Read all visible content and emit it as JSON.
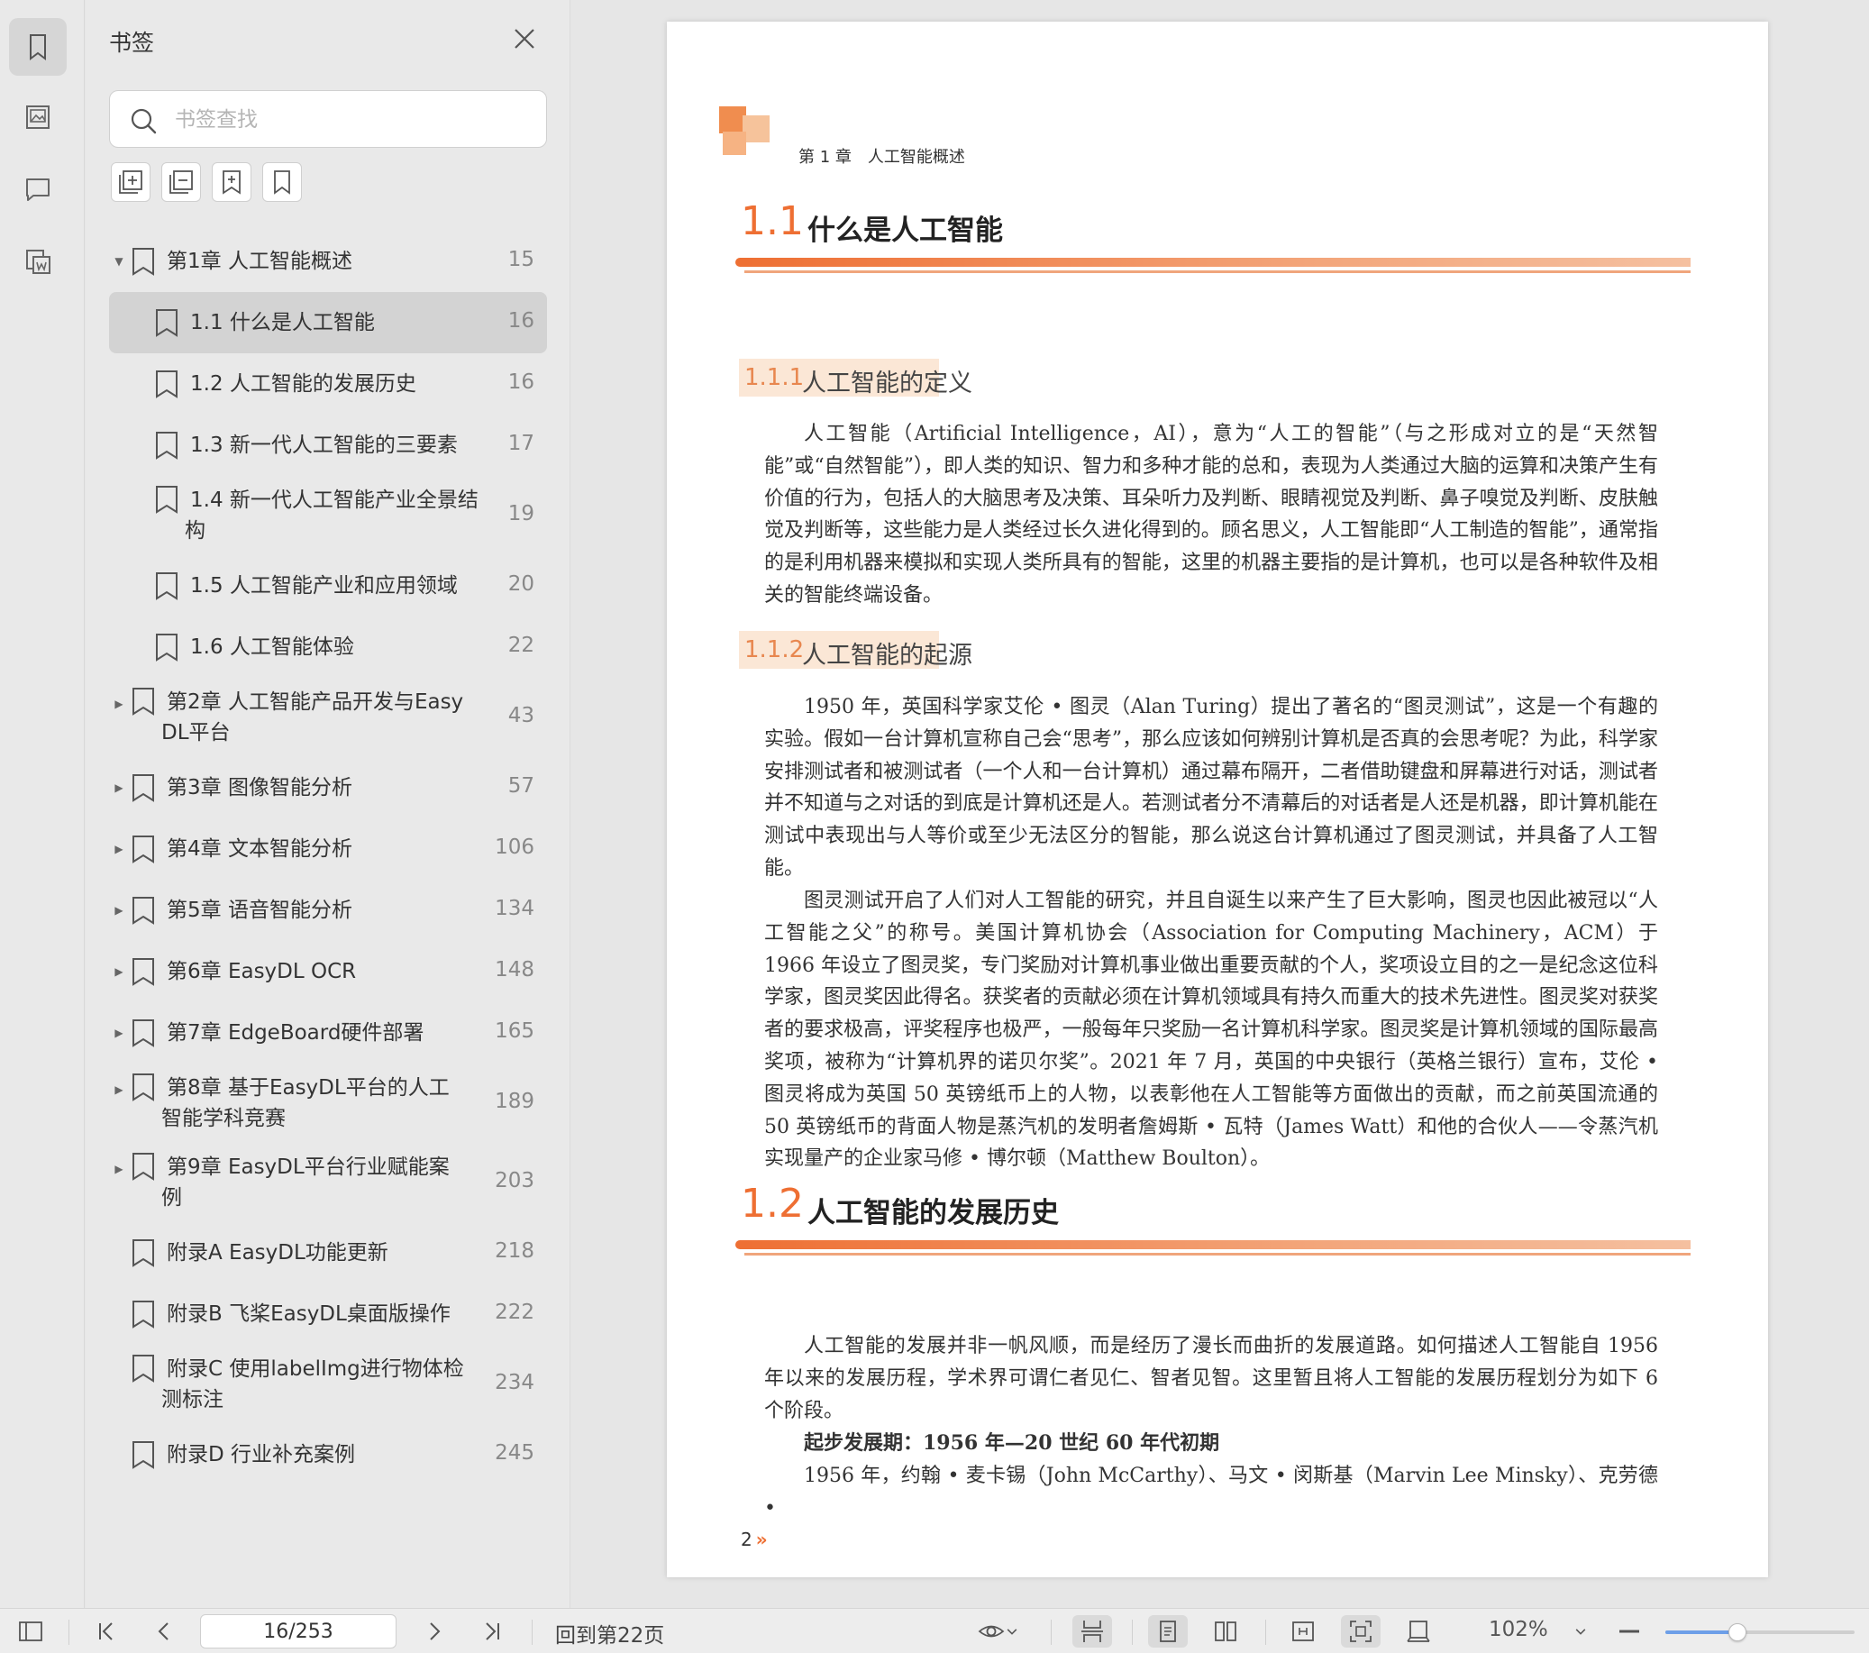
{
  "panel": {
    "title": "书签",
    "search_placeholder": "书签查找"
  },
  "bookmarks": [
    {
      "label": "第1章 人工智能概述",
      "page": "15",
      "level": 0,
      "expandable": true,
      "expanded": true
    },
    {
      "label": "1.1 什么是人工智能",
      "page": "16",
      "level": 1,
      "selected": true
    },
    {
      "label": "1.2 人工智能的发展历史",
      "page": "16",
      "level": 1
    },
    {
      "label": "1.3 新一代人工智能的三要素",
      "page": "17",
      "level": 1
    },
    {
      "label": "1.4 新一代人工智能产业全景结",
      "label2": "构",
      "page": "19",
      "level": 1
    },
    {
      "label": "1.5 人工智能产业和应用领域",
      "page": "20",
      "level": 1
    },
    {
      "label": "1.6 人工智能体验",
      "page": "22",
      "level": 1
    },
    {
      "label": "第2章 人工智能产品开发与Easy",
      "label2": "DL平台",
      "page": "43",
      "level": 0,
      "expandable": true
    },
    {
      "label": "第3章 图像智能分析",
      "page": "57",
      "level": 0,
      "expandable": true
    },
    {
      "label": "第4章 文本智能分析",
      "page": "106",
      "level": 0,
      "expandable": true
    },
    {
      "label": "第5章 语音智能分析",
      "page": "134",
      "level": 0,
      "expandable": true
    },
    {
      "label": "第6章 EasyDL OCR",
      "page": "148",
      "level": 0,
      "expandable": true
    },
    {
      "label": "第7章 EdgeBoard硬件部署",
      "page": "165",
      "level": 0,
      "expandable": true
    },
    {
      "label": "第8章 基于EasyDL平台的人工",
      "label2": "智能学科竞赛",
      "page": "189",
      "level": 0,
      "expandable": true
    },
    {
      "label": "第9章 EasyDL平台行业赋能案",
      "label2": "例",
      "page": "203",
      "level": 0,
      "expandable": true
    },
    {
      "label": "附录A EasyDL功能更新",
      "page": "218",
      "level": 0
    },
    {
      "label": "附录B 飞桨EasyDL桌面版操作",
      "page": "222",
      "level": 0
    },
    {
      "label": "附录C 使用labelImg进行物体检",
      "label2": "测标注",
      "page": "234",
      "level": 0
    },
    {
      "label": "附录D 行业补充案例",
      "page": "245",
      "level": 0
    }
  ],
  "document": {
    "running_head": "第 1 章　人工智能概述",
    "sec1_num": "1.1",
    "sec1_title": "什么是人工智能",
    "sub1_num": "1.1.1",
    "sub1_title": "人工智能的定义",
    "p1": "人工智能（Artificial Intelligence，AI），意为“人工的智能”（与之形成对立的是“天然智能”或“自然智能”），即人类的知识、智力和多种才能的总和，表现为人类通过大脑的运算和决策产生有价值的行为，包括人的大脑思考及决策、耳朵听力及判断、眼睛视觉及判断、鼻子嗅觉及判断、皮肤触觉及判断等，这些能力是人类经过长久进化得到的。顾名思义，人工智能即“人工制造的智能”，通常指的是利用机器来模拟和实现人类所具有的智能，这里的机器主要指的是计算机，也可以是各种软件及相关的智能终端设备。",
    "sub2_num": "1.1.2",
    "sub2_title": "人工智能的起源",
    "p2": "1950 年，英国科学家艾伦 • 图灵（Alan Turing）提出了著名的“图灵测试”，这是一个有趣的实验。假如一台计算机宣称自己会“思考”，那么应该如何辨别计算机是否真的会思考呢？为此，科学家安排测试者和被测试者（一个人和一台计算机）通过幕布隔开，二者借助键盘和屏幕进行对话，测试者并不知道与之对话的到底是计算机还是人。若测试者分不清幕后的对话者是人还是机器，即计算机能在测试中表现出与人等价或至少无法区分的智能，那么说这台计算机通过了图灵测试，并具备了人工智能。",
    "p3": "图灵测试开启了人们对人工智能的研究，并且自诞生以来产生了巨大影响，图灵也因此被冠以“人工智能之父”的称号。美国计算机协会（Association for Computing Machinery，ACM）于 1966 年设立了图灵奖，专门奖励对计算机事业做出重要贡献的个人，奖项设立目的之一是纪念这位科学家，图灵奖因此得名。获奖者的贡献必须在计算机领域具有持久而重大的技术先进性。图灵奖对获奖者的要求极高，评奖程序也极严，一般每年只奖励一名计算机科学家。图灵奖是计算机领域的国际最高奖项，被称为“计算机界的诺贝尔奖”。2021 年 7 月，英国的中央银行（英格兰银行）宣布，艾伦 • 图灵将成为英国 50 英镑纸币上的人物，以表彰他在人工智能等方面做出的贡献，而之前英国流通的 50 英镑纸币的背面人物是蒸汽机的发明者詹姆斯 • 瓦特（James Watt）和他的合伙人——令蒸汽机实现量产的企业家马修 • 博尔顿（Matthew Boulton）。",
    "sec2_num": "1.2",
    "sec2_title": "人工智能的发展历史",
    "p4": "人工智能的发展并非一帆风顺，而是经历了漫长而曲折的发展道路。如何描述人工智能自 1956 年以来的发展历程，学术界可谓仁者见仁、智者见智。这里暂且将人工智能的发展历程划分为如下 6 个阶段。",
    "p5": "起步发展期：1956 年—20 世纪 60 年代初期",
    "p6": "1956 年，约翰 • 麦卡锡（John McCarthy）、马文 • 闵斯基（Marvin Lee Minsky）、克劳德 •",
    "page_number": "2"
  },
  "statusbar": {
    "page_field": "16/253",
    "goto_label": "回到第22页",
    "zoom": "102%",
    "zoom_fraction": 0.38
  },
  "colors": {
    "accent": "#ee6f33",
    "selected_row": "#d3d3d3",
    "slider": "#6d9fe8"
  }
}
